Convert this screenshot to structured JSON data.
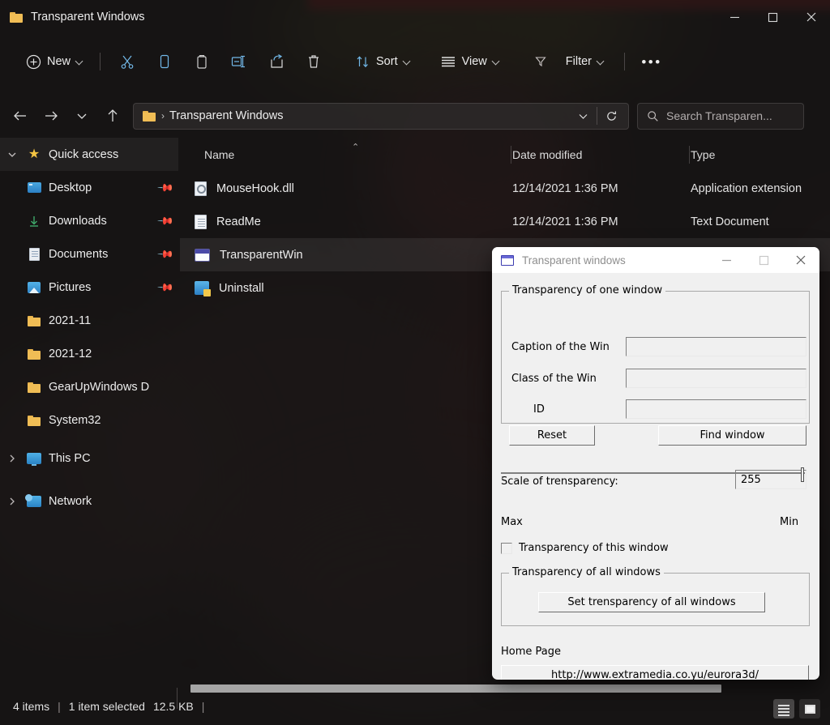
{
  "window": {
    "title": "Transparent Windows",
    "title_icon": "folder-icon",
    "minimize": "—",
    "maximize": "□",
    "close": "✕"
  },
  "toolbar": {
    "new_label": "New",
    "sort_label": "Sort",
    "view_label": "View",
    "filter_label": "Filter",
    "overflow_label": "•••",
    "icons": [
      "plus-circle-icon",
      "cut-icon",
      "copy-icon",
      "paste-icon",
      "rename-icon",
      "share-icon",
      "delete-icon",
      "sort-icon",
      "view-icon",
      "filter-icon",
      "more-icon"
    ]
  },
  "navbar": {
    "back": "←",
    "forward": "→",
    "recent": "⌄",
    "up": "↑",
    "breadcrumb_separator": "›",
    "breadcrumb_text": "Transparent Windows",
    "dropdown": "⌄",
    "refresh": "↻"
  },
  "search": {
    "placeholder": "Search Transparen...",
    "icon": "search-icon"
  },
  "sidebar": {
    "items": [
      {
        "label": "Quick access",
        "icon": "star-icon",
        "expander": "chevron-down",
        "pinned": false,
        "indent": false,
        "selected": true
      },
      {
        "label": "Desktop",
        "icon": "desktop-icon",
        "expander": "",
        "pinned": true,
        "indent": true,
        "selected": false
      },
      {
        "label": "Downloads",
        "icon": "download-icon",
        "expander": "",
        "pinned": true,
        "indent": true,
        "selected": false
      },
      {
        "label": "Documents",
        "icon": "documents-icon",
        "expander": "",
        "pinned": true,
        "indent": true,
        "selected": false
      },
      {
        "label": "Pictures",
        "icon": "pictures-icon",
        "expander": "",
        "pinned": true,
        "indent": true,
        "selected": false
      },
      {
        "label": "2021-11",
        "icon": "folder-icon",
        "expander": "",
        "pinned": false,
        "indent": true,
        "selected": false
      },
      {
        "label": "2021-12",
        "icon": "folder-icon",
        "expander": "",
        "pinned": false,
        "indent": true,
        "selected": false
      },
      {
        "label": "GearUpWindows D",
        "icon": "folder-icon",
        "expander": "",
        "pinned": false,
        "indent": true,
        "selected": false
      },
      {
        "label": "System32",
        "icon": "folder-icon",
        "expander": "",
        "pinned": false,
        "indent": true,
        "selected": false
      },
      {
        "label": "This PC",
        "icon": "pc-icon",
        "expander": "chevron-right",
        "pinned": false,
        "indent": false,
        "selected": false
      },
      {
        "label": "Network",
        "icon": "network-icon",
        "expander": "chevron-right",
        "pinned": false,
        "indent": false,
        "selected": false
      }
    ],
    "pin_glyph": "📌"
  },
  "filelist": {
    "columns": [
      {
        "label": "Name"
      },
      {
        "label": "Date modified"
      },
      {
        "label": "Type"
      }
    ],
    "sort_indicator": "⌃",
    "rows": [
      {
        "name": "MouseHook.dll",
        "date": "12/14/2021 1:36 PM",
        "type": "Application extension",
        "icon": "dll-file-icon",
        "selected": false
      },
      {
        "name": "ReadMe",
        "date": "12/14/2021 1:36 PM",
        "type": "Text Document",
        "icon": "text-file-icon",
        "selected": false
      },
      {
        "name": "TransparentWin",
        "date": "",
        "type": "",
        "icon": "application-icon",
        "selected": true
      },
      {
        "name": "Uninstall",
        "date": "",
        "type": "",
        "icon": "uninstall-icon",
        "selected": false
      }
    ]
  },
  "statusbar": {
    "item_count": "4 items",
    "separator": "|",
    "selection": "1 item selected",
    "size": "12.5 KB",
    "trailing_separator": "|",
    "view_details_icon": "details-view-icon",
    "view_tiles_icon": "large-icons-view-icon"
  },
  "dialog": {
    "title": "Transparent windows",
    "icon": "window-icon",
    "minimize": "—",
    "maximize": "□",
    "close": "✕",
    "group_one": {
      "title": "Transparency of one window",
      "fields": [
        {
          "label": "Caption of the Win",
          "value": ""
        },
        {
          "label": "Class of the Win",
          "value": ""
        },
        {
          "label": "ID",
          "value": ""
        }
      ],
      "reset_button": "Reset",
      "find_button": "Find window"
    },
    "scale": {
      "label": "Scale of trensparency:",
      "value": "255",
      "min_label": "Max",
      "max_label": "Min"
    },
    "checkbox": {
      "label": "Transparency of this window",
      "checked": false
    },
    "group_all": {
      "title": "Transparency of all windows",
      "button": "Set trensparency of all windows"
    },
    "homepage": {
      "label": "Home Page",
      "url_button": "http://www.extramedia.co.yu/eurora3d/"
    }
  },
  "colors": {
    "accent_blue": "#72b8e8",
    "folder_yellow": "#f0bd55",
    "star_yellow": "#f5c542",
    "dialog_face": "#f0f0f0",
    "window_bg": "#181616"
  }
}
